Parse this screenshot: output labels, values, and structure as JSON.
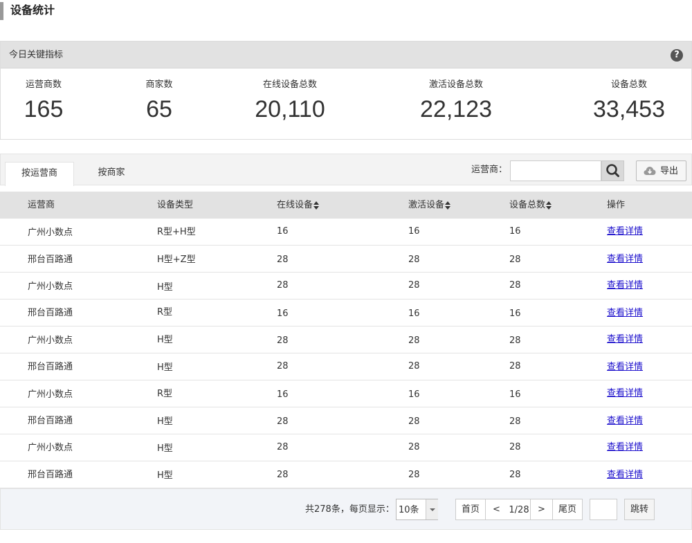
{
  "page": {
    "title": "设备统计"
  },
  "kpi": {
    "heading": "今日关键指标",
    "help_icon": "question-circle-icon",
    "items": [
      {
        "label": "运营商数",
        "value": "165"
      },
      {
        "label": "商家数",
        "value": "65"
      },
      {
        "label": "在线设备总数",
        "value": "20,110"
      },
      {
        "label": "激活设备总数",
        "value": "22,123"
      },
      {
        "label": "设备总数",
        "value": "33,453"
      }
    ]
  },
  "tabs": [
    {
      "label": "按运营商",
      "active": true
    },
    {
      "label": "按商家",
      "active": false
    }
  ],
  "filter": {
    "label": "运营商：",
    "value": "",
    "placeholder": "",
    "search_icon": "search-icon",
    "export_icon": "cloud-download-icon",
    "export_label": "导出"
  },
  "table": {
    "headers": [
      "运营商",
      "设备类型",
      "在线设备",
      "激活设备",
      "设备总数",
      "操作"
    ],
    "rows": [
      {
        "operator": "广州小数点",
        "type": "R型+H型",
        "online": "16",
        "active": "16",
        "total": "16",
        "action": "查看详情"
      },
      {
        "operator": "邢台百路通",
        "type": "H型+Z型",
        "online": "28",
        "active": "28",
        "total": "28",
        "action": "查看详情"
      },
      {
        "operator": "广州小数点",
        "type": "H型",
        "online": "28",
        "active": "28",
        "total": "28",
        "action": "查看详情"
      },
      {
        "operator": "邢台百路通",
        "type": "R型",
        "online": "16",
        "active": "16",
        "total": "16",
        "action": "查看详情"
      },
      {
        "operator": "广州小数点",
        "type": "H型",
        "online": "28",
        "active": "28",
        "total": "28",
        "action": "查看详情"
      },
      {
        "operator": "邢台百路通",
        "type": "H型",
        "online": "28",
        "active": "28",
        "total": "28",
        "action": "查看详情"
      },
      {
        "operator": "广州小数点",
        "type": "R型",
        "online": "16",
        "active": "16",
        "total": "16",
        "action": "查看详情"
      },
      {
        "operator": "邢台百路通",
        "type": "H型",
        "online": "28",
        "active": "28",
        "total": "28",
        "action": "查看详情"
      },
      {
        "operator": "广州小数点",
        "type": "H型",
        "online": "28",
        "active": "28",
        "total": "28",
        "action": "查看详情"
      },
      {
        "operator": "邢台百路通",
        "type": "H型",
        "online": "28",
        "active": "28",
        "total": "28",
        "action": "查看详情"
      }
    ]
  },
  "pagination": {
    "info": "共278条，每页显示：",
    "page_size": "10条",
    "first": "首页",
    "prev": "<",
    "current": "1/28",
    "next": ">",
    "last": "尾页",
    "jump_value": "",
    "jump": "跳转"
  }
}
